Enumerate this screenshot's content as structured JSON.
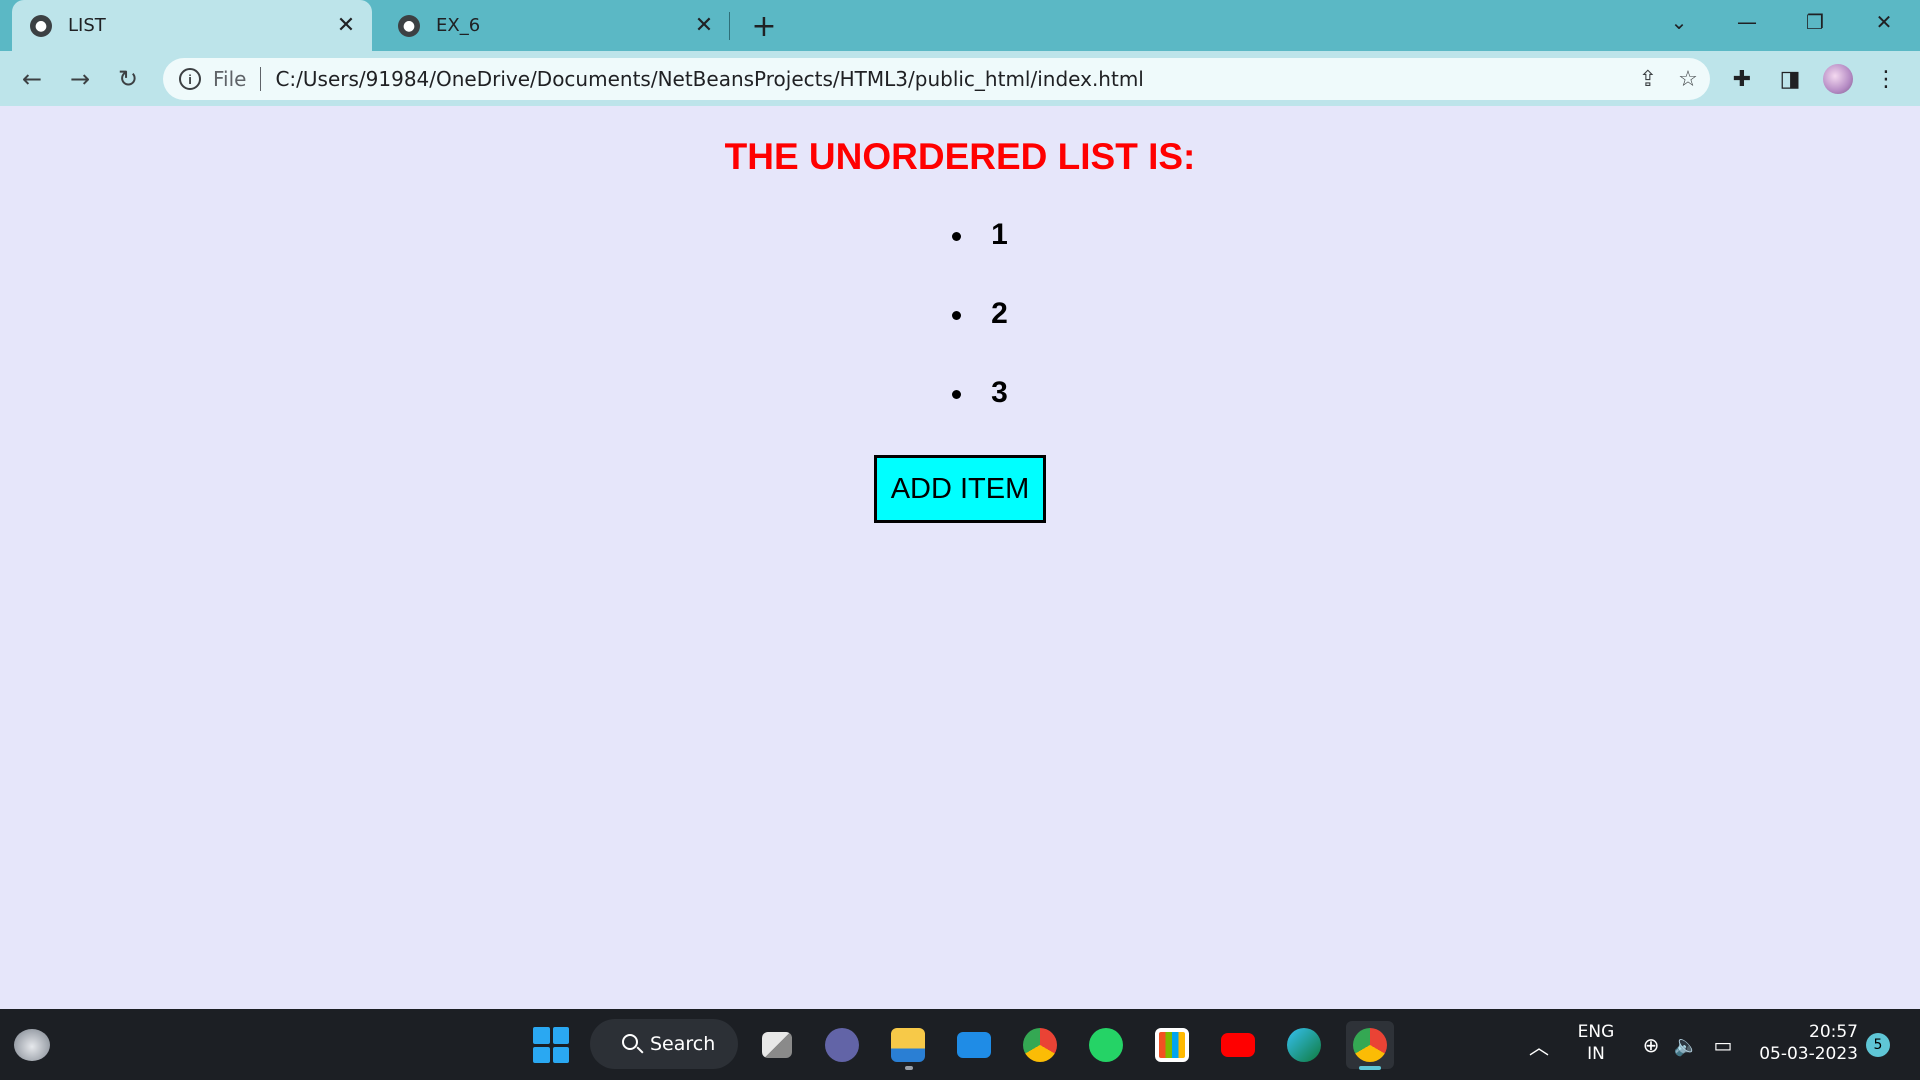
{
  "browser": {
    "tabs": [
      {
        "title": "LIST",
        "active": true
      },
      {
        "title": "EX_6",
        "active": false
      }
    ],
    "new_tab_icon": "plus-icon",
    "window_controls": [
      "chevron-down-icon",
      "minimize-icon",
      "restore-icon",
      "close-icon"
    ],
    "omnibox": {
      "scheme_label": "File",
      "url": "C:/Users/91984/OneDrive/Documents/NetBeansProjects/HTML3/public_html/index.html"
    },
    "colors": {
      "tabstrip": "#5bb8c5",
      "toolbar": "#bde4ea"
    }
  },
  "page": {
    "heading": "THE UNORDERED LIST IS:",
    "list_items": [
      "1",
      "2",
      "3"
    ],
    "add_button_label": "ADD ITEM",
    "colors": {
      "background": "#e6e6fa",
      "heading": "#ff0000",
      "button": "#00ffff"
    }
  },
  "taskbar": {
    "search_label": "Search",
    "apps": [
      "task-view",
      "teams",
      "file-explorer",
      "mail",
      "chrome",
      "whatsapp",
      "microsoft-store",
      "youtube",
      "edge",
      "chrome-active"
    ],
    "language": {
      "line1": "ENG",
      "line2": "IN"
    },
    "time": "20:57",
    "date": "05-03-2023",
    "notification_count": "5"
  }
}
